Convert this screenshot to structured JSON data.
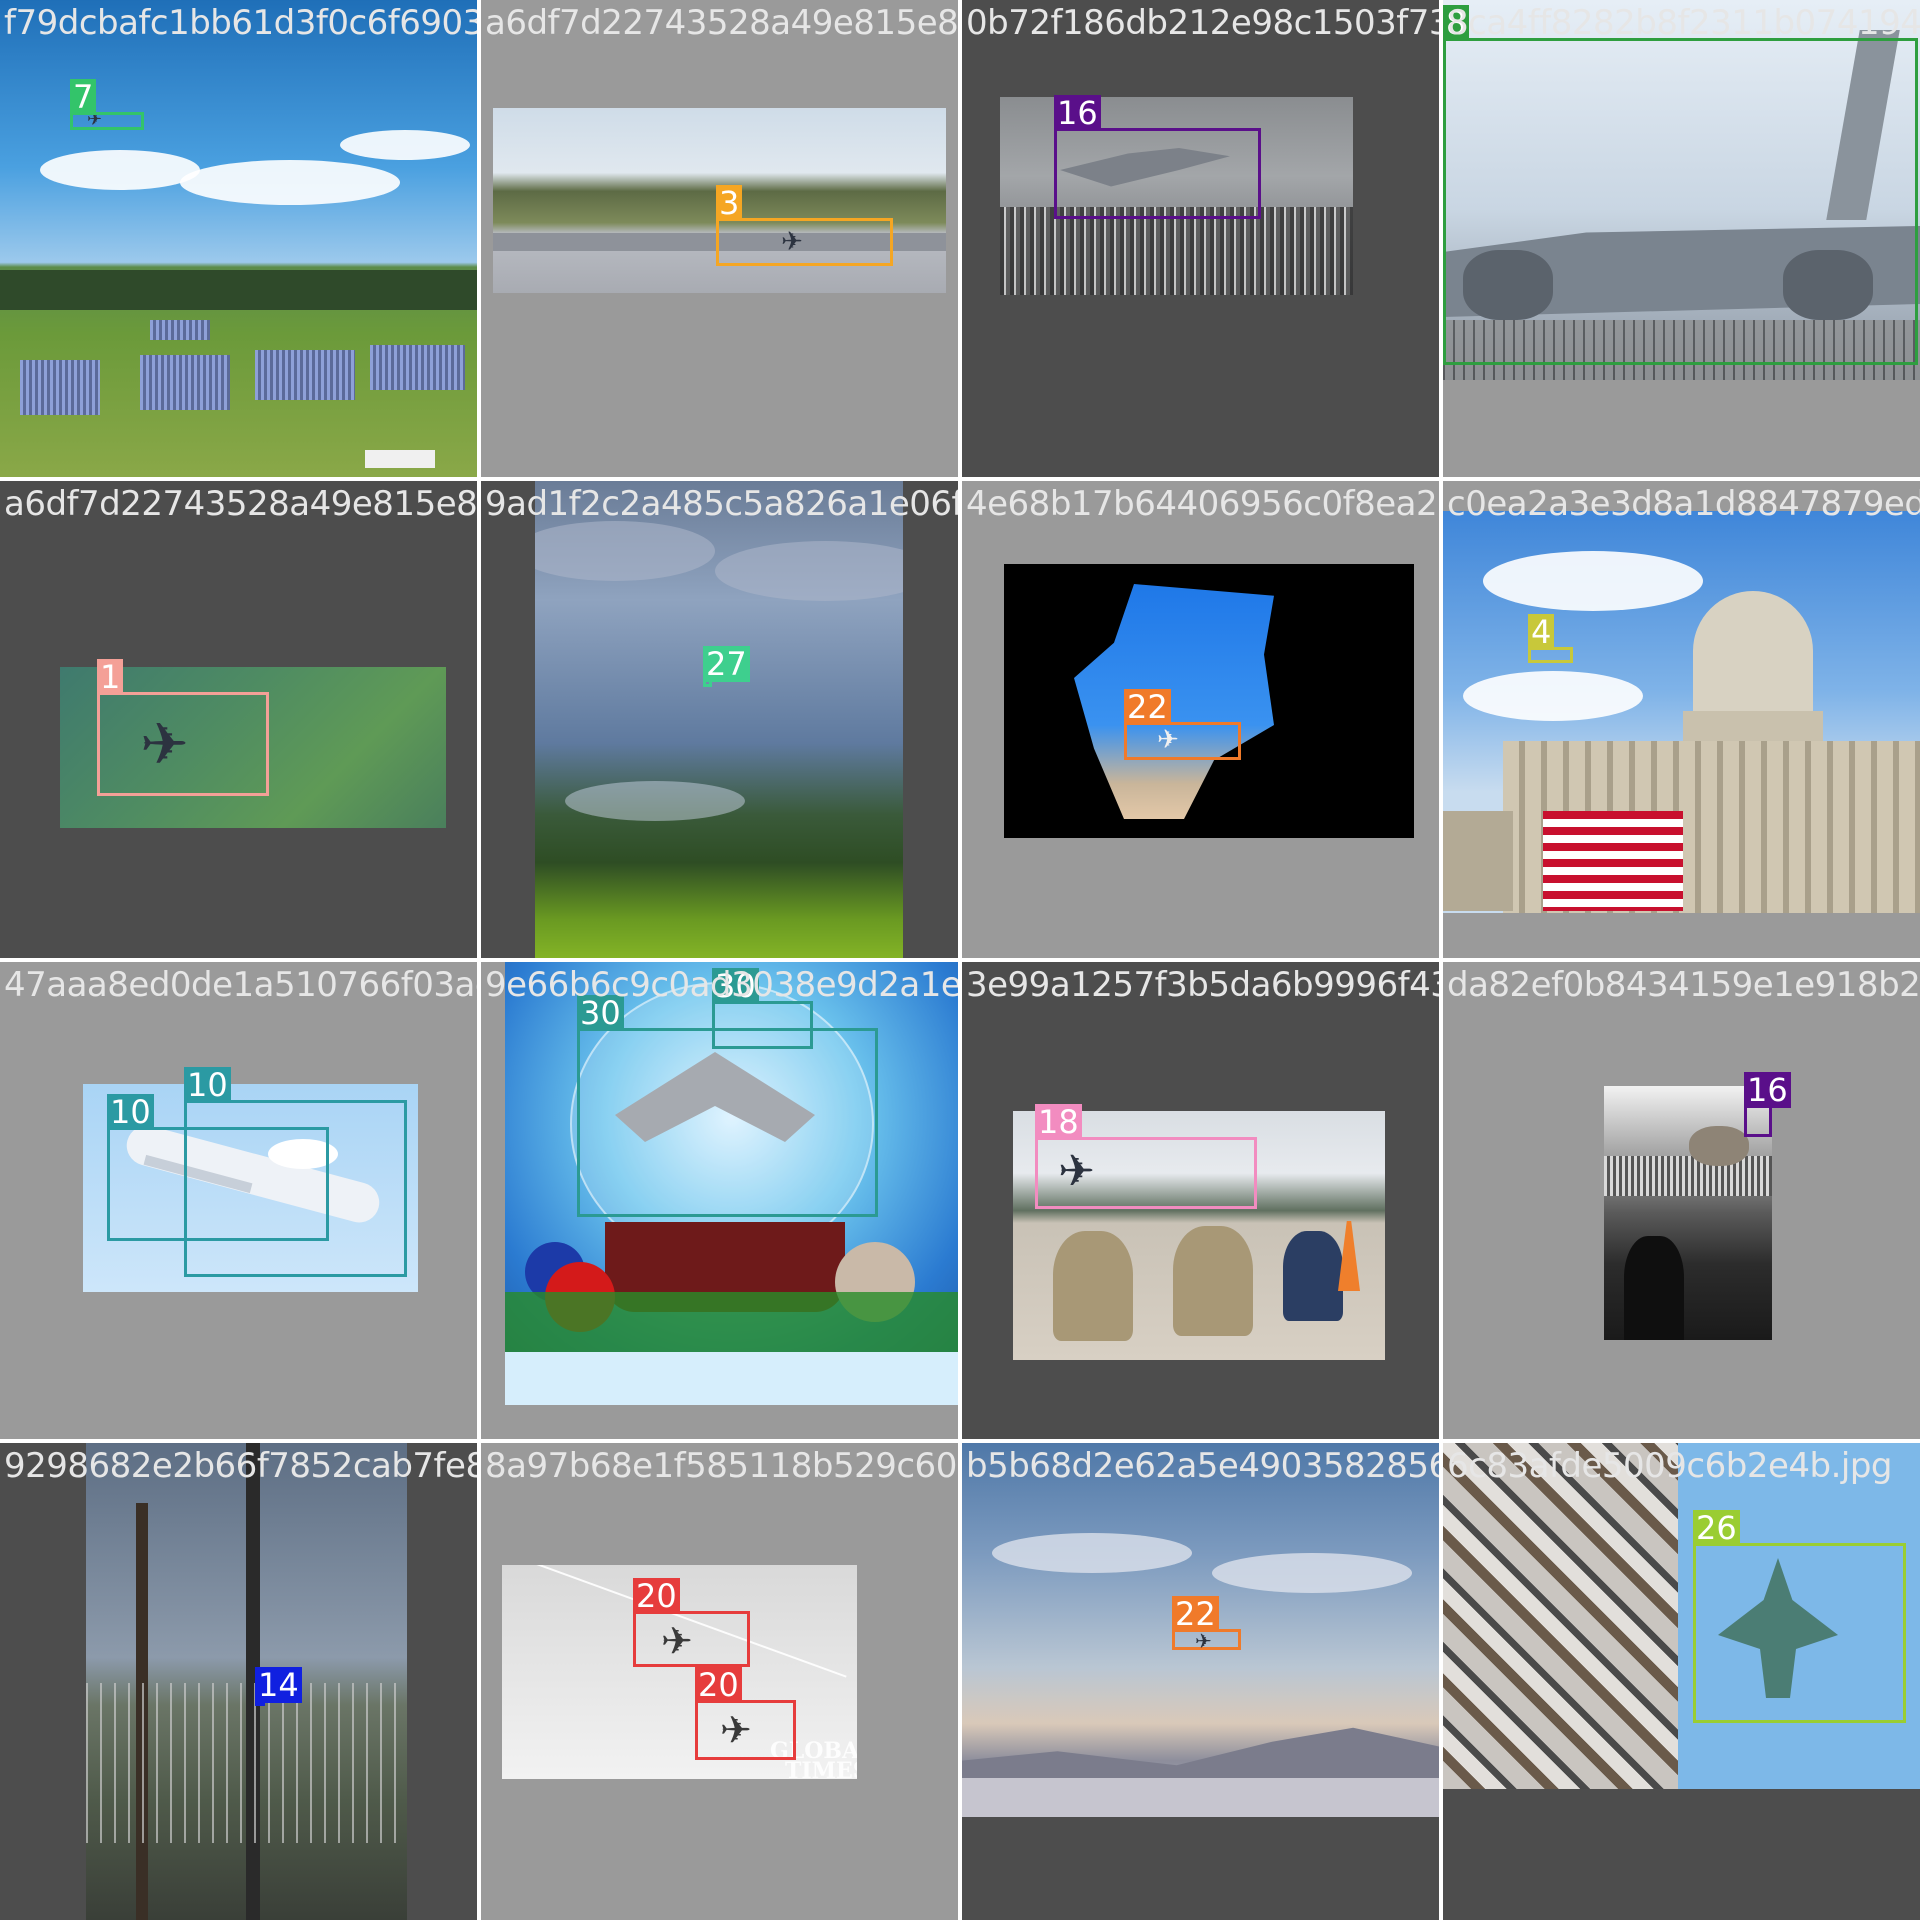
{
  "tiles": [
    {
      "id": "t0",
      "filename": "f79dcbafc1bb61d3f0c6f6903b4687f6397.jpg",
      "bg": "#4d4d4d",
      "scene": "scene-parade",
      "boxes": [
        {
          "label": "7",
          "color": "#33c46a"
        }
      ]
    },
    {
      "id": "t1",
      "filename": "a6df7d22743528a49e815e89adb5e96c293.jpg",
      "bg": "#9a9a9a",
      "scene": "scene-runway",
      "boxes": [
        {
          "label": "3",
          "color": "#f5a623"
        }
      ]
    },
    {
      "id": "t2",
      "filename": "0b72f186db212e98c1503f738f4dd6d3.jpg",
      "bg": "#4d4d4d",
      "scene": "scene-airshow",
      "boxes": [
        {
          "label": "16",
          "color": "#5a0f8a"
        }
      ]
    },
    {
      "id": "t3",
      "filename": "8ca4ff8282b8f2311b07419413.jpg",
      "bg": "#9a9a9a",
      "scene": "scene-c17",
      "boxes": [
        {
          "label": "8",
          "color": "#2e9e3f"
        }
      ]
    },
    {
      "id": "t4",
      "filename": "a6df7d22743528a49e815e89adb5e96c2.jpg",
      "bg": "#4d4d4d",
      "scene": "scene-a400",
      "boxes": [
        {
          "label": "1",
          "color": "#f4a097"
        }
      ]
    },
    {
      "id": "t5",
      "filename": "9ad1f2c2a485c5a826a1e06f4762d03b.jpg",
      "bg": "#4d4d4d",
      "scene": "scene-forest",
      "boxes": [
        {
          "label": "27",
          "color": "#3ecf8e"
        }
      ]
    },
    {
      "id": "t6",
      "filename": "4e68b17b64406956c0f8ea2d68.jpg",
      "bg": "#9a9a9a",
      "scene": "scene-drone-cutout",
      "boxes": [
        {
          "label": "22",
          "color": "#f07a2a"
        }
      ]
    },
    {
      "id": "t7",
      "filename": "c0ea2a3e3d8a1d8847879eda.jpg",
      "bg": "#9a9a9a",
      "scene": "scene-capitol",
      "boxes": [
        {
          "label": "4",
          "color": "#c8c83a"
        }
      ]
    },
    {
      "id": "t8",
      "filename": "47aaa8ed0de1a510766f03ae6d5682d5.jpg",
      "bg": "#9a9a9a",
      "scene": "scene-hawkeye",
      "boxes": [
        {
          "label": "10",
          "color": "#2b9aa3"
        },
        {
          "label": "10",
          "color": "#2b9aa3"
        }
      ]
    },
    {
      "id": "t9",
      "filename": "9e66b6c9c0ad3038e9d2a1ee7183.jpg",
      "bg": "#9a9a9a",
      "scene": "scene-snowglobe",
      "boxes": [
        {
          "label": "30",
          "color": "#2b9a93"
        },
        {
          "label": "30",
          "color": "#2b9a93"
        }
      ]
    },
    {
      "id": "t10",
      "filename": "3e99a1257f3b5da6b9996f430df5d0f4b.jpg",
      "bg": "#4d4d4d",
      "scene": "scene-f35",
      "boxes": [
        {
          "label": "18",
          "color": "#f28cc0"
        }
      ]
    },
    {
      "id": "t11",
      "filename": "da82ef0b8434159e1e918b2e.jpg",
      "bg": "#9a9a9a",
      "scene": "scene-carrier",
      "boxes": [
        {
          "label": "16",
          "color": "#5a0f8a"
        }
      ]
    },
    {
      "id": "t12",
      "filename": "9298682e2b66f7852cab7fe88a97b08d1.jpg",
      "bg": "#4d4d4d",
      "scene": "scene-fence",
      "boxes": [
        {
          "label": "14",
          "color": "#1020e0"
        }
      ]
    },
    {
      "id": "t13",
      "filename": "8a97b68e1f585118b529c60b5398742a62.jpg",
      "bg": "#9a9a9a",
      "scene": "scene-j20",
      "boxes": [
        {
          "label": "20",
          "color": "#e63c3c"
        },
        {
          "label": "20",
          "color": "#e63c3c"
        }
      ],
      "watermark_lines": [
        "GLOBAL",
        "TIMES"
      ]
    },
    {
      "id": "t14",
      "filename": "b5b68d2e62a5e4903582856c63a8d753.jpg",
      "bg": "#4d4d4d",
      "scene": "scene-mountains",
      "boxes": [
        {
          "label": "22",
          "color": "#f07a2a"
        }
      ]
    },
    {
      "id": "t15",
      "filename": "6c83afde5009c6b2e4b.jpg",
      "bg": "#4d4d4d",
      "scene": "scene-su34",
      "boxes": [
        {
          "label": "26",
          "color": "#9acd32"
        }
      ]
    }
  ]
}
